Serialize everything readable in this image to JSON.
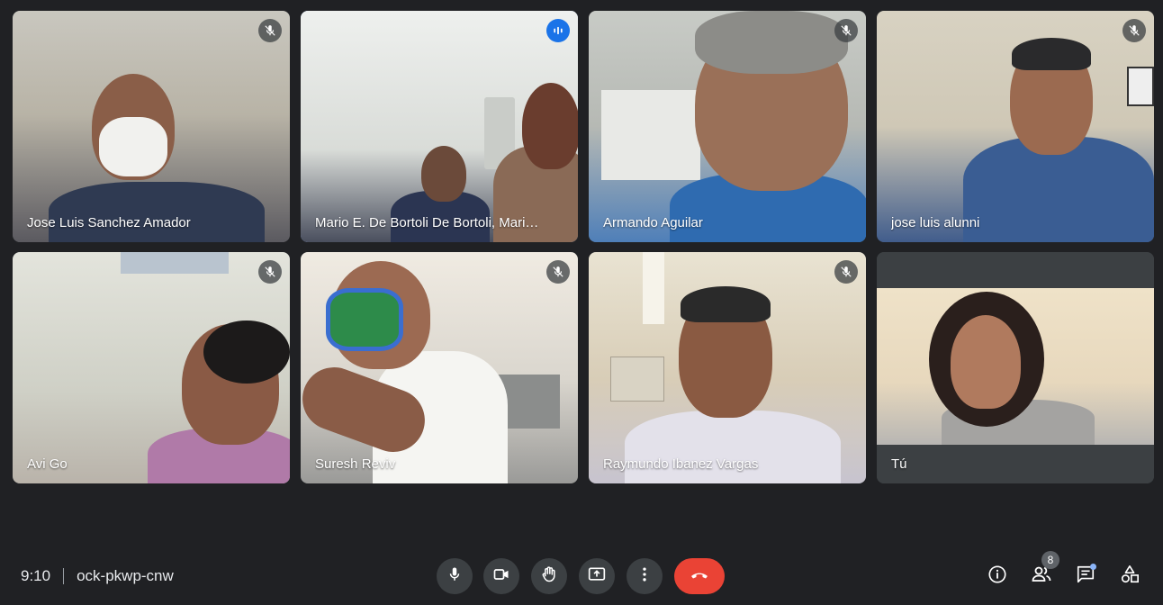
{
  "participants": [
    {
      "name": "Jose Luis Sanchez Amador",
      "muted": true
    },
    {
      "name": "Mario E. De Bortoli De Bortoli, Mario Ed...",
      "muted": false,
      "speaking": true
    },
    {
      "name": "Armando Aguilar",
      "muted": true
    },
    {
      "name": "jose luis alunni",
      "muted": true
    },
    {
      "name": "Avi Go",
      "muted": true
    },
    {
      "name": "Suresh Reviv",
      "muted": true
    },
    {
      "name": "Raymundo Ibanez Vargas",
      "muted": true
    },
    {
      "name": "Tú",
      "muted": false
    }
  ],
  "meeting": {
    "time": "9:10",
    "code": "ock-pkwp-cnw"
  },
  "controls": {
    "icons": [
      "mic-icon",
      "camera-icon",
      "raise-hand-icon",
      "present-icon",
      "more-options-icon",
      "end-call-icon"
    ]
  },
  "side_panel": {
    "people_count": "8",
    "icons": [
      "info-icon",
      "people-icon",
      "chat-icon",
      "activities-icon"
    ]
  },
  "colors": {
    "background": "#202124",
    "tile": "#3c4043",
    "button": "#3c4043",
    "end_call": "#ea4335",
    "active_border": "#8ab4f8",
    "speaking": "#1a73e8"
  }
}
